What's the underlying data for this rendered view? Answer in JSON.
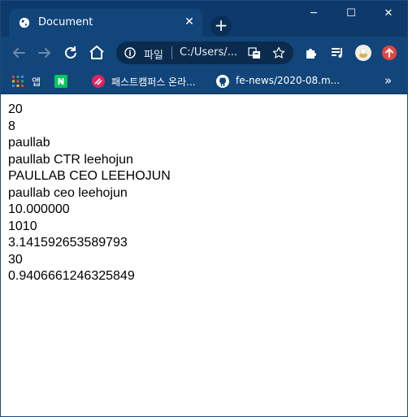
{
  "tab": {
    "title": "Document",
    "close_symbol": "✕"
  },
  "new_tab_symbol": "+",
  "window_controls": {
    "minimize": "─",
    "maximize": "☐",
    "close": "✕"
  },
  "omnibox": {
    "scheme_label": "파일",
    "url": "C:/Users/..."
  },
  "bookmarks": {
    "apps_label": "앱",
    "items": [
      {
        "label": "패스트캠퍼스 온라..."
      },
      {
        "label": "fe-news/2020-08.m..."
      }
    ],
    "more_symbol": "»"
  },
  "output_lines": [
    "20",
    "8",
    "paullab",
    "paullab CTR leehojun",
    "PAULLAB CEO LEEHOJUN",
    "paullab ceo leehojun",
    "10.000000",
    "1010",
    "3.141592653589793",
    "30",
    "0.9406661246325849"
  ],
  "colors": {
    "titlebar": "#0d3a6a",
    "toolbar": "#12457a",
    "omnibox": "#0a2b4d",
    "page_background": "#ffffff",
    "text": "#000000"
  }
}
